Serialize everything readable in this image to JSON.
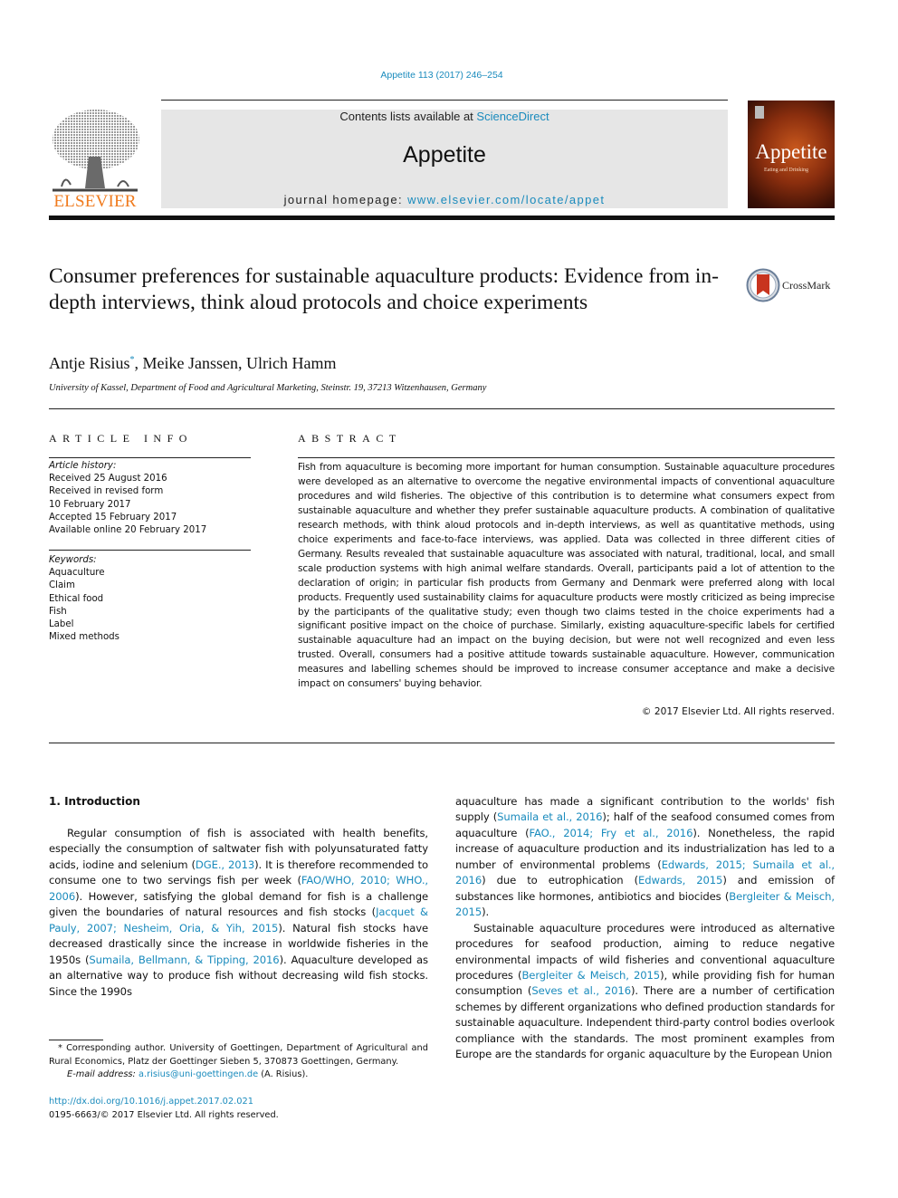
{
  "header": {
    "citation": "Appetite 113 (2017) 246–254",
    "contents_prefix": "Contents lists available at ",
    "contents_link": "ScienceDirect",
    "journal_title": "Appetite",
    "homepage_prefix": "journal homepage: ",
    "homepage_link": "www.elsevier.com/locate/appet",
    "publisher_logo_text": "ELSEVIER",
    "cover_title": "Appetite",
    "cover_subtitle": "Eating and Drinking",
    "colors": {
      "link": "#1a8bbd",
      "elsevier_orange": "#f07b1e",
      "banner_bg": "#e6e6e6"
    }
  },
  "article": {
    "title": "Consumer preferences for sustainable aquaculture products: Evidence from in-depth interviews, think aloud protocols and choice experiments",
    "crossmark_label": "CrossMark",
    "authors": [
      {
        "name": "Antje Risius",
        "mark": "*"
      },
      {
        "name": "Meike Janssen",
        "mark": ""
      },
      {
        "name": "Ulrich Hamm",
        "mark": ""
      }
    ],
    "authors_sep": ", ",
    "affiliation": "University of Kassel, Department of Food and Agricultural Marketing, Steinstr. 19, 37213 Witzenhausen, Germany"
  },
  "article_info": {
    "heading": "ARTICLE INFO",
    "history_label": "Article history:",
    "history": [
      "Received 25 August 2016",
      "Received in revised form",
      "10 February 2017",
      "Accepted 15 February 2017",
      "Available online 20 February 2017"
    ],
    "keywords_label": "Keywords:",
    "keywords": [
      "Aquaculture",
      "Claim",
      "Ethical food",
      "Fish",
      "Label",
      "Mixed methods"
    ]
  },
  "abstract": {
    "heading": "ABSTRACT",
    "text": "Fish from aquaculture is becoming more important for human consumption. Sustainable aquaculture procedures were developed as an alternative to overcome the negative environmental impacts of conventional aquaculture procedures and wild fisheries. The objective of this contribution is to determine what consumers expect from sustainable aquaculture and whether they prefer sustainable aquaculture products. A combination of qualitative research methods, with think aloud protocols and in-depth interviews, as well as quantitative methods, using choice experiments and face-to-face interviews, was applied. Data was collected in three different cities of Germany. Results revealed that sustainable aquaculture was associated with natural, traditional, local, and small scale production systems with high animal welfare standards. Overall, participants paid a lot of attention to the declaration of origin; in particular fish products from Germany and Denmark were preferred along with local products. Frequently used sustainability claims for aquaculture products were mostly criticized as being imprecise by the participants of the qualitative study; even though two claims tested in the choice experiments had a significant positive impact on the choice of purchase. Similarly, existing aquaculture-specific labels for certified sustainable aquaculture had an impact on the buying decision, but were not well recognized and even less trusted. Overall, consumers had a positive attitude towards sustainable aquaculture. However, communication measures and labelling schemes should be improved to increase consumer acceptance and make a decisive impact on consumers' buying behavior.",
    "copyright": "© 2017 Elsevier Ltd. All rights reserved."
  },
  "body": {
    "intro_heading": "1.  Introduction",
    "left_column": [
      {
        "t": "Regular consumption of fish is associated with health benefits, especially the consumption of saltwater fish with polyunsaturated fatty acids, iodine and selenium ("
      },
      {
        "t": "DGE., 2013",
        "link": true
      },
      {
        "t": "). It is therefore recommended to consume one to two servings fish per week ("
      },
      {
        "t": "FAO/WHO, 2010; WHO., 2006",
        "link": true
      },
      {
        "t": "). However, satisfying the global demand for fish is a challenge given the boundaries of natural resources and fish stocks ("
      },
      {
        "t": "Jacquet & Pauly, 2007; Nesheim, Oria, & Yih, 2015",
        "link": true
      },
      {
        "t": "). Natural fish stocks have decreased drastically since the increase in worldwide fisheries in the 1950s ("
      },
      {
        "t": "Sumaila, Bellmann, & Tipping, 2016",
        "link": true
      },
      {
        "t": "). Aquaculture developed as an alternative way to produce fish without decreasing wild fish stocks. Since the 1990s"
      }
    ],
    "right_column_p1": [
      {
        "t": "aquaculture has made a significant contribution to the worlds' fish supply ("
      },
      {
        "t": "Sumaila et al., 2016",
        "link": true
      },
      {
        "t": "); half of the seafood consumed comes from aquaculture ("
      },
      {
        "t": "FAO., 2014; Fry et al., 2016",
        "link": true
      },
      {
        "t": "). Nonetheless, the rapid increase of aquaculture production and its industrialization has led to a number of environmental problems ("
      },
      {
        "t": "Edwards, 2015; Sumaila et al., 2016",
        "link": true
      },
      {
        "t": ") due to eutrophication ("
      },
      {
        "t": "Edwards, 2015",
        "link": true
      },
      {
        "t": ") and emission of substances like hormones, antibiotics and biocides ("
      },
      {
        "t": "Bergleiter & Meisch, 2015",
        "link": true
      },
      {
        "t": ")."
      }
    ],
    "right_column_p2": [
      {
        "t": "Sustainable aquaculture procedures were introduced as alternative procedures for seafood production, aiming to reduce negative environmental impacts of wild fisheries and conventional aquaculture procedures ("
      },
      {
        "t": "Bergleiter & Meisch, 2015",
        "link": true
      },
      {
        "t": "), while providing fish for human consumption ("
      },
      {
        "t": "Seves et al., 2016",
        "link": true
      },
      {
        "t": "). There are a number of certification schemes by different organizations who defined production standards for sustainable aquaculture. Independent third-party control bodies overlook compliance with the standards. The most prominent examples from Europe are the standards for organic aquaculture by the European Union"
      }
    ]
  },
  "footnote": {
    "corresponding": "* Corresponding author. University of Goettingen, Department of Agricultural and Rural Economics, Platz der Goettinger Sieben 5, 370873 Goettingen, Germany.",
    "email_label": "E-mail address: ",
    "email": "a.risius@uni-goettingen.de",
    "email_suffix": " (A. Risius).",
    "doi": "http://dx.doi.org/10.1016/j.appet.2017.02.021",
    "issn": "0195-6663/© 2017 Elsevier Ltd. All rights reserved."
  }
}
